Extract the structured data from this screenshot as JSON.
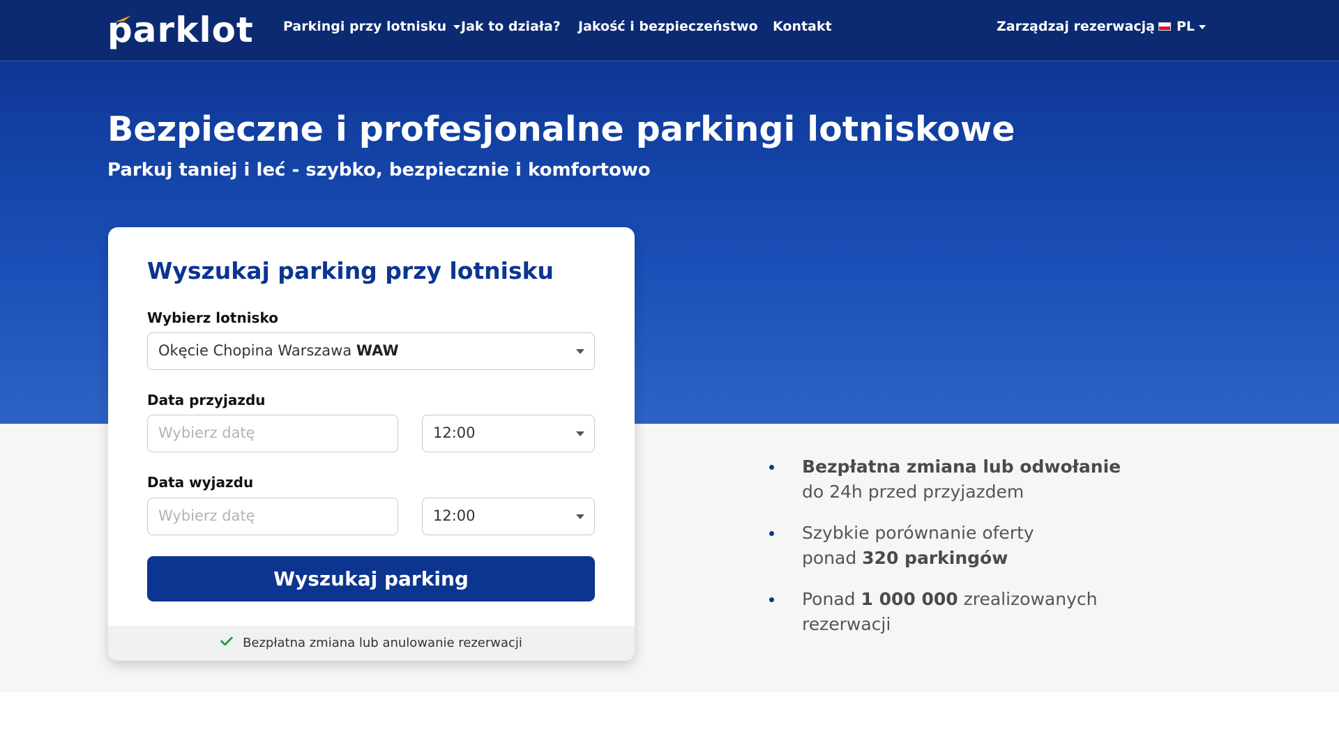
{
  "brand": {
    "logo_text": "parklot"
  },
  "nav": {
    "items": [
      {
        "label": "Parkingi przy lotnisku",
        "has_dropdown": true
      },
      {
        "label": "Jak to działa?"
      },
      {
        "label": "Jakość i bezpieczeństwo"
      },
      {
        "label": "Kontakt"
      }
    ],
    "manage": "Zarządzaj rezerwacją",
    "language": "PL"
  },
  "hero": {
    "title": "Bezpieczne i profesjonalne parkingi lotniskowe",
    "subtitle": "Parkuj taniej i leć - szybko, bezpiecznie i komfortowo"
  },
  "search": {
    "title": "Wyszukaj parking przy lotnisku",
    "airport_label": "Wybierz lotnisko",
    "airport_name": "Okęcie Chopina Warszawa",
    "airport_code": "WAW",
    "arrival_label": "Data przyjazdu",
    "departure_label": "Data wyjazdu",
    "date_placeholder": "Wybierz datę",
    "arrival_time": "12:00",
    "departure_time": "12:00",
    "button": "Wyszukaj parking",
    "footer_note": "Bezpłatna zmiana lub anulowanie rezerwacji"
  },
  "features": [
    {
      "bold": "Bezpłatna zmiana lub odwołanie",
      "rest": "do 24h przed przyjazdem"
    },
    {
      "pre": "Szybkie porównanie oferty",
      "mid": "ponad ",
      "bold": "320 parkingów"
    },
    {
      "pre": "Ponad ",
      "bold": "1 000 000",
      "rest": " zrealizowanych rezerwacji"
    }
  ],
  "colors": {
    "primary": "#0c3590",
    "nav_bg": "#0b2a72",
    "check": "#1a9b3a"
  }
}
